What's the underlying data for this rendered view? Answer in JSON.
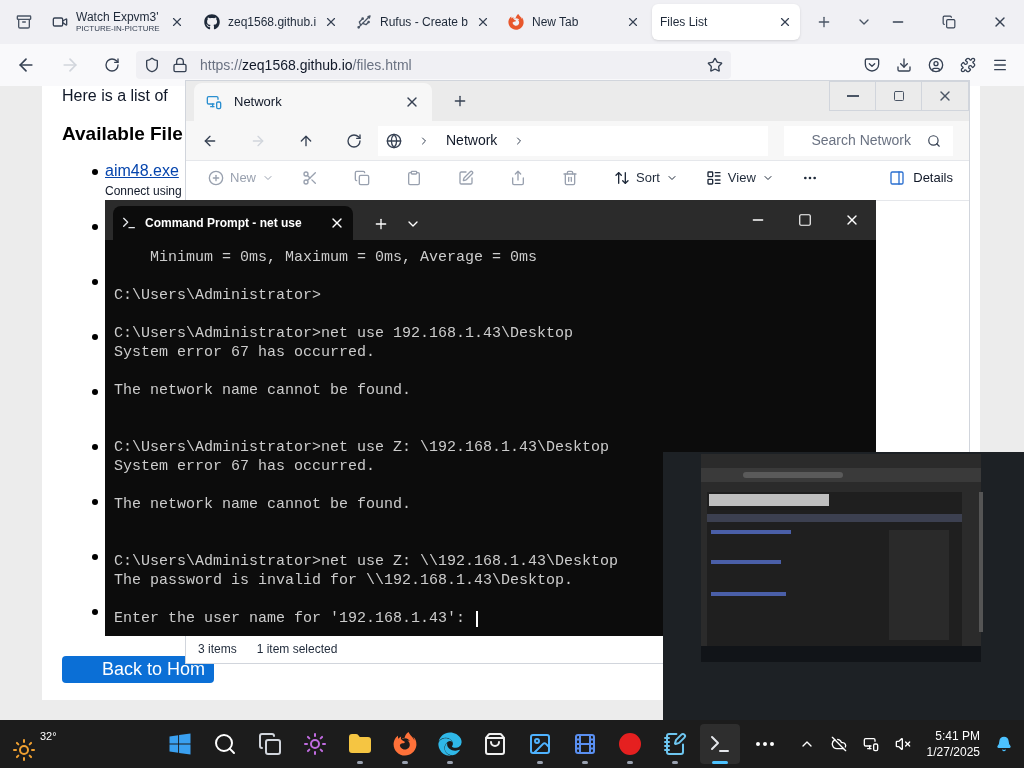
{
  "browser": {
    "tabs": [
      {
        "kind": "video",
        "title": "Watch Expvm3'",
        "subtitle": "PICTURE-IN-PICTURE",
        "selected": false
      },
      {
        "kind": "github",
        "title": "zeq1568.github.i",
        "selected": false
      },
      {
        "kind": "usb",
        "title": "Rufus - Create b",
        "selected": false
      },
      {
        "kind": "firefox",
        "title": "New Tab",
        "selected": false
      },
      {
        "kind": "plain",
        "title": "Files List",
        "selected": true
      }
    ],
    "url": {
      "scheme": "https://",
      "domain": "zeq1568.github.io",
      "path": "/files.html"
    }
  },
  "page": {
    "intro": "Here is a list of",
    "heading": "Available File",
    "items": [
      {
        "kind": "file",
        "name": "aim48.exe",
        "description": "Connect using"
      },
      {
        "kind": "covered"
      },
      {
        "kind": "covered"
      },
      {
        "kind": "covered"
      },
      {
        "kind": "covered"
      },
      {
        "kind": "covered"
      },
      {
        "kind": "covered"
      },
      {
        "kind": "covered"
      },
      {
        "kind": "covered"
      }
    ],
    "back_button": "Back to Hom"
  },
  "explorer": {
    "tab": "Network",
    "breadcrumb": "Network",
    "search_placeholder": "Search Network",
    "toolbar": [
      {
        "kind": "new",
        "label": "New",
        "disabled": true
      },
      {
        "kind": "cut",
        "disabled": true
      },
      {
        "kind": "copy",
        "disabled": true
      },
      {
        "kind": "paste",
        "disabled": true
      },
      {
        "kind": "rename",
        "disabled": true
      },
      {
        "kind": "share",
        "disabled": true
      },
      {
        "kind": "delete",
        "disabled": true
      },
      {
        "kind": "sort",
        "label": "Sort",
        "disabled": false
      },
      {
        "kind": "view",
        "label": "View",
        "disabled": false
      },
      {
        "kind": "more",
        "disabled": false
      }
    ],
    "details": "Details",
    "status": [
      "3 items",
      "1 item selected"
    ]
  },
  "terminal": {
    "title": "Command Prompt - net use",
    "lines": [
      {
        "kind": "text",
        "text": "    Minimum = 0ms, Maximum = 0ms, Average = 0ms"
      },
      {
        "kind": "blank"
      },
      {
        "kind": "text",
        "text": "C:\\Users\\Administrator>"
      },
      {
        "kind": "blank"
      },
      {
        "kind": "text",
        "text": "C:\\Users\\Administrator>net use 192.168.1.43\\Desktop"
      },
      {
        "kind": "text",
        "text": "System error 67 has occurred."
      },
      {
        "kind": "blank"
      },
      {
        "kind": "text",
        "text": "The network name cannot be found."
      },
      {
        "kind": "blank"
      },
      {
        "kind": "blank"
      },
      {
        "kind": "text",
        "text": "C:\\Users\\Administrator>net use Z: \\192.168.1.43\\Desktop"
      },
      {
        "kind": "text",
        "text": "System error 67 has occurred."
      },
      {
        "kind": "blank"
      },
      {
        "kind": "text",
        "text": "The network name cannot be found."
      },
      {
        "kind": "blank"
      },
      {
        "kind": "blank"
      },
      {
        "kind": "text",
        "text": "C:\\Users\\Administrator>net use Z: \\\\192.168.1.43\\Desktop"
      },
      {
        "kind": "text",
        "text": "The password is invalid for \\\\192.168.1.43\\Desktop."
      },
      {
        "kind": "blank"
      },
      {
        "kind": "prompt",
        "text": "Enter the user name for '192.168.1.43':"
      }
    ]
  },
  "taskbar": {
    "weather": "32°",
    "apps": [
      {
        "kind": "start",
        "running": false,
        "selected": false
      },
      {
        "kind": "search",
        "running": false,
        "selected": false
      },
      {
        "kind": "taskview",
        "running": false,
        "selected": false
      },
      {
        "kind": "copilot",
        "running": false,
        "selected": false
      },
      {
        "kind": "folder",
        "running": true,
        "selected": false
      },
      {
        "kind": "firefox",
        "running": true,
        "selected": false
      },
      {
        "kind": "edge",
        "running": true,
        "selected": false
      },
      {
        "kind": "store",
        "running": false,
        "selected": false
      },
      {
        "kind": "photos",
        "running": true,
        "selected": false
      },
      {
        "kind": "film",
        "running": true,
        "selected": false
      },
      {
        "kind": "record",
        "running": true,
        "selected": false
      },
      {
        "kind": "notepad",
        "running": true,
        "selected": false
      },
      {
        "kind": "terminal",
        "running": true,
        "selected": true
      },
      {
        "kind": "more",
        "running": false,
        "selected": false
      }
    ],
    "time": "5:41 PM",
    "date": "1/27/2025"
  }
}
